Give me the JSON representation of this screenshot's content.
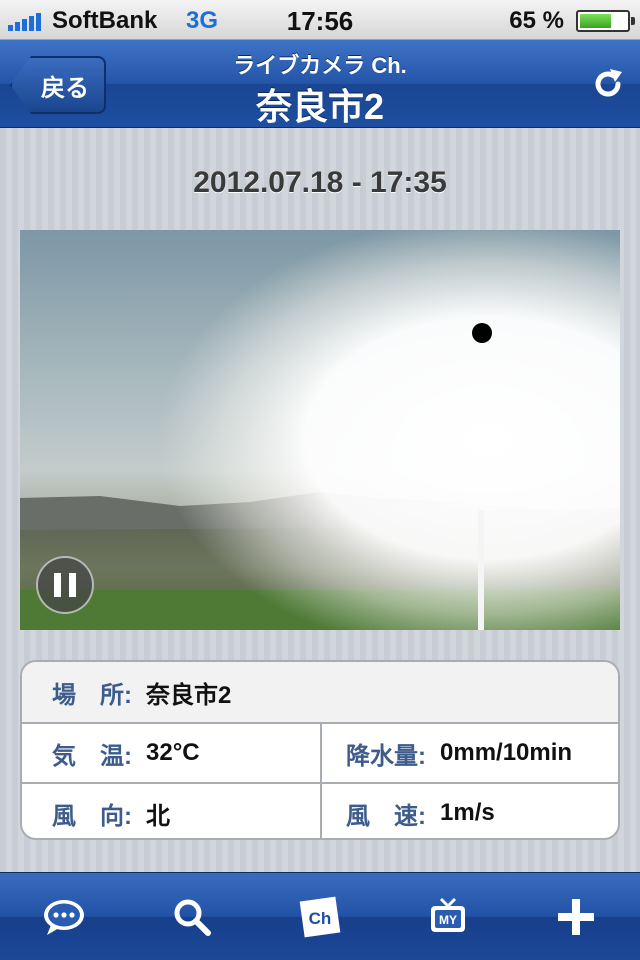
{
  "status_bar": {
    "carrier": "SoftBank",
    "network": "3G",
    "time": "17:56",
    "battery_percent": "65 %",
    "battery_level": 0.65
  },
  "nav": {
    "back_label": "戻る",
    "subtitle": "ライブカメラ Ch.",
    "title": "奈良市2",
    "refresh_icon": "refresh-icon"
  },
  "timestamp": "2012.07.18 - 17:35",
  "camera": {
    "pause_icon": "pause-icon"
  },
  "info": {
    "location": {
      "label": "場　所:",
      "value": "奈良市2"
    },
    "temperature": {
      "label": "気　温:",
      "value": "32°C"
    },
    "precipitation": {
      "label": "降水量:",
      "value": "0mm/10min"
    },
    "wind_direction": {
      "label": "風　向:",
      "value": "北"
    },
    "wind_speed": {
      "label": "風　速:",
      "value": "1m/s"
    }
  },
  "tab_bar": {
    "items": [
      "chat-icon",
      "search-icon",
      "channel-icon",
      "my-tv-icon",
      "add-icon"
    ],
    "channel_text": "Ch",
    "my_text": "MY"
  },
  "colors": {
    "nav_blue": "#2455a8",
    "label_blue": "#3d5c8c"
  }
}
